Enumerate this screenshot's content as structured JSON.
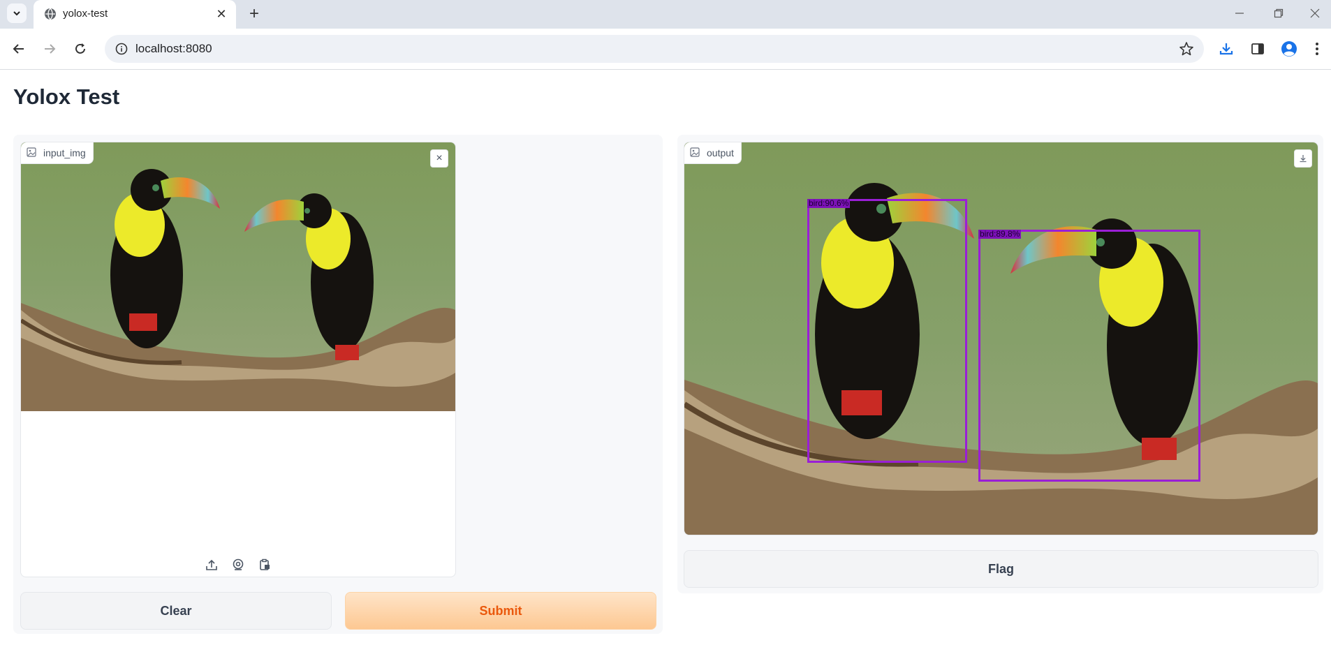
{
  "browser": {
    "tab_title": "yolox-test",
    "url": "localhost:8080",
    "tab_close_glyph": "✕",
    "new_tab_glyph": "+"
  },
  "page": {
    "title": "Yolox Test"
  },
  "input": {
    "label": "input_img",
    "icon": "image-icon",
    "remove_glyph": "×"
  },
  "output": {
    "label": "output",
    "icon": "image-icon",
    "detections": [
      {
        "label": "bird:90.6%"
      },
      {
        "label": "bird:89.8%"
      }
    ]
  },
  "buttons": {
    "clear": "Clear",
    "submit": "Submit",
    "flag": "Flag"
  },
  "colors": {
    "accent": "#ea580c",
    "detection_box": "#9a1fd6",
    "submit_bg": "#fdc892"
  }
}
